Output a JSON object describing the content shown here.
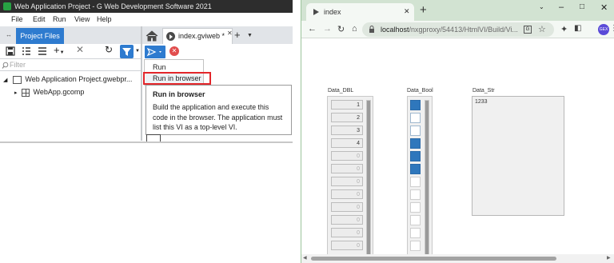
{
  "ide": {
    "title": "Web Application Project - G Web Development Software 2021",
    "menu": [
      "File",
      "Edit",
      "Run",
      "View",
      "Help"
    ],
    "project_tab": "Project Files",
    "doc_tab": "index.gviweb *",
    "filter_placeholder": "Filter",
    "tree": {
      "project": "Web Application Project.gwebpr...",
      "component": "WebApp.gcomp"
    },
    "run_menu": {
      "run": "Run",
      "run_in_browser": "Run in browser"
    },
    "tooltip": {
      "title": "Run in browser",
      "body": "Build the application and execute this code in the browser. The application must list this VI as a top-level VI."
    }
  },
  "browser": {
    "tab_title": "index",
    "url_host": "localhost",
    "url_path": "/nxgproxy/54413/HtmlVI/Build/Vi...",
    "profile_initials": "GEX"
  },
  "panel": {
    "dbl_label": "Data_DBL",
    "bool_label": "Data_Bool",
    "str_label": "Data_Str",
    "dbl_values": [
      "1",
      "2",
      "3",
      "4",
      "0",
      "0",
      "0",
      "0",
      "0",
      "0",
      "0",
      "0"
    ],
    "dbl_set_count": 4,
    "bool_values": [
      true,
      false,
      false,
      true,
      true,
      true,
      false,
      false,
      false,
      false,
      false,
      false
    ],
    "bool_set_count": 6,
    "str_value": "1233",
    "colors": {
      "bool_on": "#2f77bc",
      "ide_accent": "#2e7bcf",
      "highlight": "#e3262b"
    }
  }
}
